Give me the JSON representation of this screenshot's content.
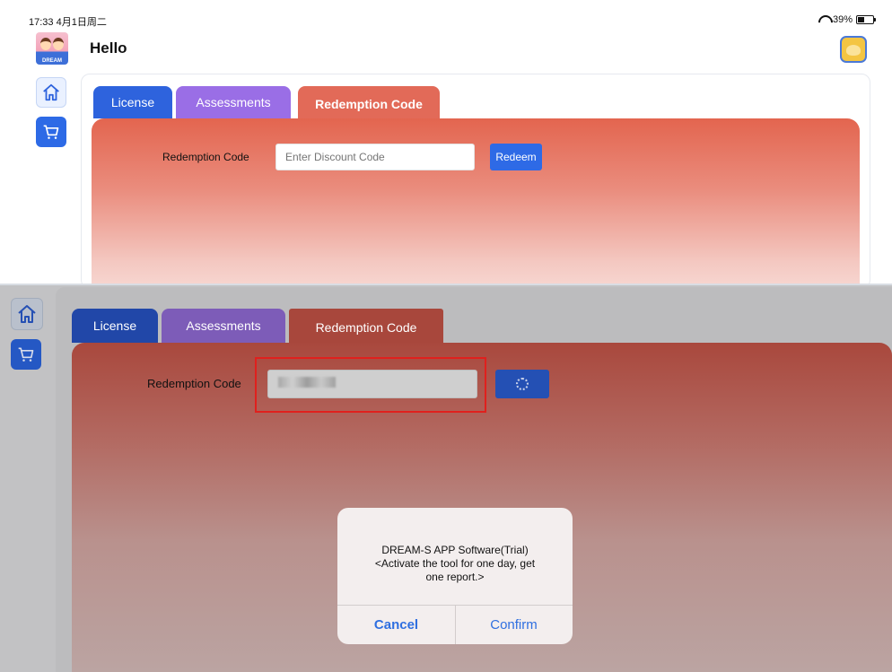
{
  "status_bar": {
    "time": "17:33 4月1日周二",
    "battery": "39%",
    "battery_level": 0.39
  },
  "header": {
    "logo_text": "DREAM",
    "greeting": "Hello"
  },
  "tabs": [
    {
      "label": "License"
    },
    {
      "label": "Assessments"
    },
    {
      "label": "Redemption Code"
    }
  ],
  "form": {
    "label": "Redemption Code",
    "placeholder": "Enter Discount Code",
    "button": "Redeem"
  },
  "dialog": {
    "line1": "DREAM-S APP Software(Trial)",
    "line2": "<Activate the tool for one day, get",
    "line3": "one report.>",
    "cancel": "Cancel",
    "confirm": "Confirm"
  },
  "colors": {
    "license_tab": "#2e63dd",
    "assessments_tab": "#9a6ee6",
    "redemption_tab": "#e26a58",
    "redeem_button": "#2e6ae6",
    "highlight_box": "#e0201d",
    "dialog_button_text": "#2f6fe0"
  }
}
